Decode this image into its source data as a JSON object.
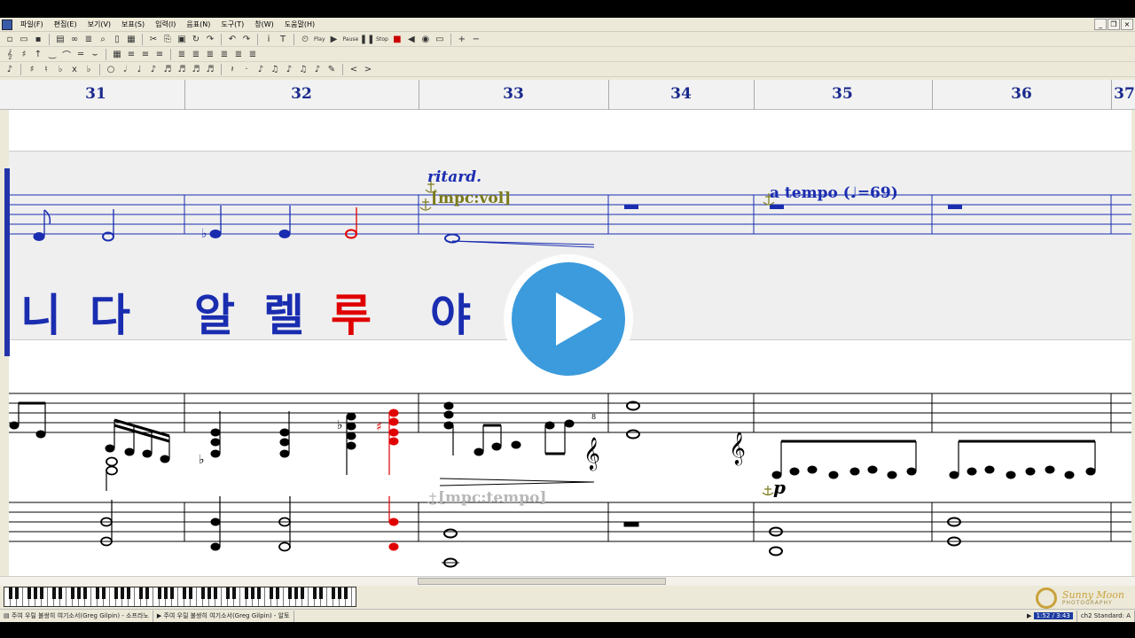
{
  "menu": {
    "items": [
      "파일(F)",
      "편집(E)",
      "보기(V)",
      "보표(S)",
      "입력(I)",
      "음표(N)",
      "도구(T)",
      "창(W)",
      "도움말(H)"
    ]
  },
  "toolbar": {
    "play_label": "Play",
    "pause_label": "Pause",
    "stop_label": "Stop"
  },
  "ruler": {
    "measures": [
      "31",
      "32",
      "33",
      "34",
      "35",
      "36",
      "37"
    ]
  },
  "score": {
    "lyrics": [
      "니",
      "다",
      "알",
      "렐",
      "루",
      "야"
    ],
    "annotations": {
      "ritard": "ritard.",
      "mpc_vol": "[mpc:vol]",
      "a_tempo": "a tempo (",
      "tempo_value": "=69)",
      "mpc_tempo": "[mpc:tempo]",
      "dynamic_p": "p",
      "octave_mark": "8"
    },
    "colors": {
      "note_blue": "#1a2db0",
      "highlight_red": "#e00000",
      "annotation_olive": "#7a7a1a",
      "annotation_grey": "#b8b8b8"
    }
  },
  "statusbar": {
    "track1": "주여 우릴 불쌍히 여기소서(Greg Gilpin) - 소프라노",
    "track2": "주여 우릴 불쌍히 여기소서(Greg Gilpin) - 알토",
    "time": "1:52 / 3:43",
    "channel": "ch2 Standard: A"
  },
  "logo": {
    "name": "Sunny Moon",
    "sub": "PHOTOGRAPHY"
  }
}
